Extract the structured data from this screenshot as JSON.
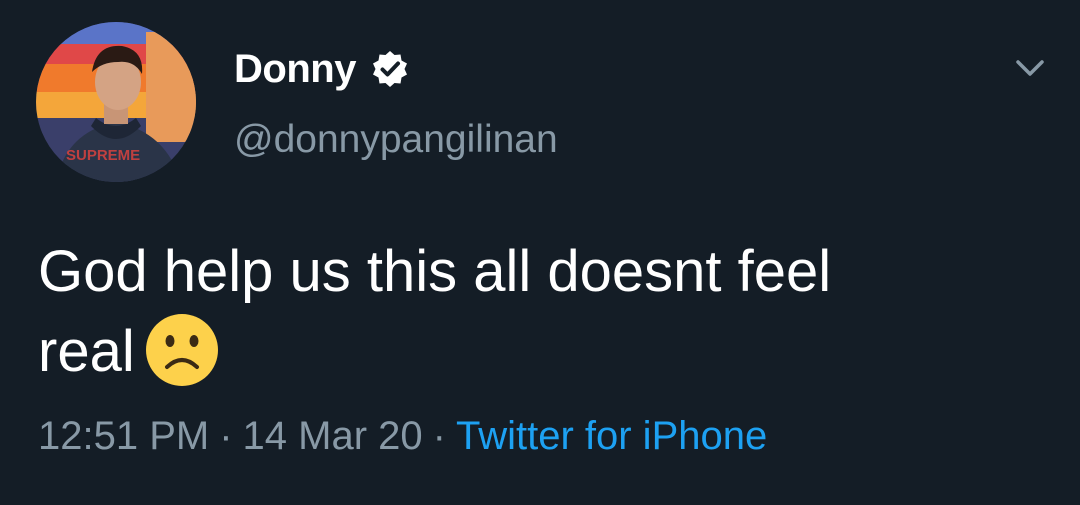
{
  "tweet": {
    "author": {
      "display_name": "Donny",
      "handle": "@donnypangilinan",
      "verified": true
    },
    "text": {
      "line1": "God help us this all doesnt feel",
      "line2": "real",
      "emoji": "frowning-face-emoji"
    },
    "meta": {
      "time": "12:51 PM",
      "separator": "·",
      "date": "14 Mar 20",
      "source": "Twitter for iPhone"
    },
    "icons": {
      "menu": "chevron-down-icon",
      "verified": "verified-badge-icon"
    }
  },
  "colors": {
    "background": "#141d26",
    "text_primary": "#ffffff",
    "text_secondary": "#8899a6",
    "link": "#1da1f2",
    "emoji": "#fdd14b"
  }
}
